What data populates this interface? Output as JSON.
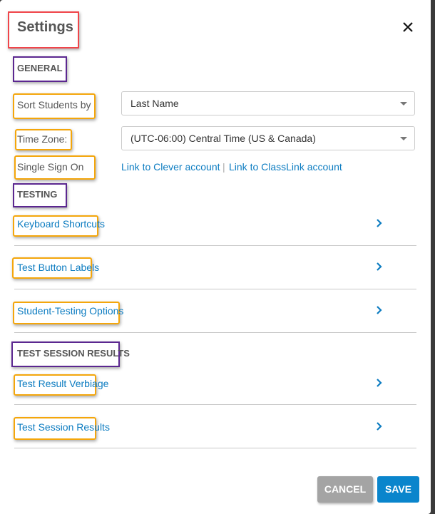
{
  "dialog": {
    "title": "Settings",
    "close_icon": "close-icon"
  },
  "general": {
    "heading": "GENERAL",
    "sort_students": {
      "label": "Sort Students by",
      "value": "Last Name"
    },
    "time_zone": {
      "label": "Time Zone:",
      "value": "(UTC-06:00) Central Time (US & Canada)"
    },
    "sso": {
      "label": "Single Sign On",
      "clever_link": "Link to Clever account",
      "separator": "|",
      "classlink_link": "Link to ClassLink account"
    }
  },
  "testing": {
    "heading": "TESTING",
    "items": [
      {
        "label": "Keyboard Shortcuts",
        "icon": "chevron-right-icon"
      },
      {
        "label": "Test Button Labels",
        "icon": "chevron-right-icon"
      },
      {
        "label": "Student-Testing Options",
        "icon": "chevron-right-icon"
      }
    ]
  },
  "results": {
    "heading": "TEST SESSION RESULTS",
    "items": [
      {
        "label": "Test Result Verbiage",
        "icon": "chevron-right-icon"
      },
      {
        "label": "Test Session Results",
        "icon": "chevron-right-icon"
      }
    ]
  },
  "footer": {
    "cancel_label": "CANCEL",
    "save_label": "SAVE"
  },
  "colors": {
    "link": "#0c7cc1",
    "save": "#0a85cc",
    "cancel": "#a4a4a4",
    "annotation_title": "#f0454a",
    "annotation_section": "#5b2790",
    "annotation_field": "#f4a60b"
  }
}
